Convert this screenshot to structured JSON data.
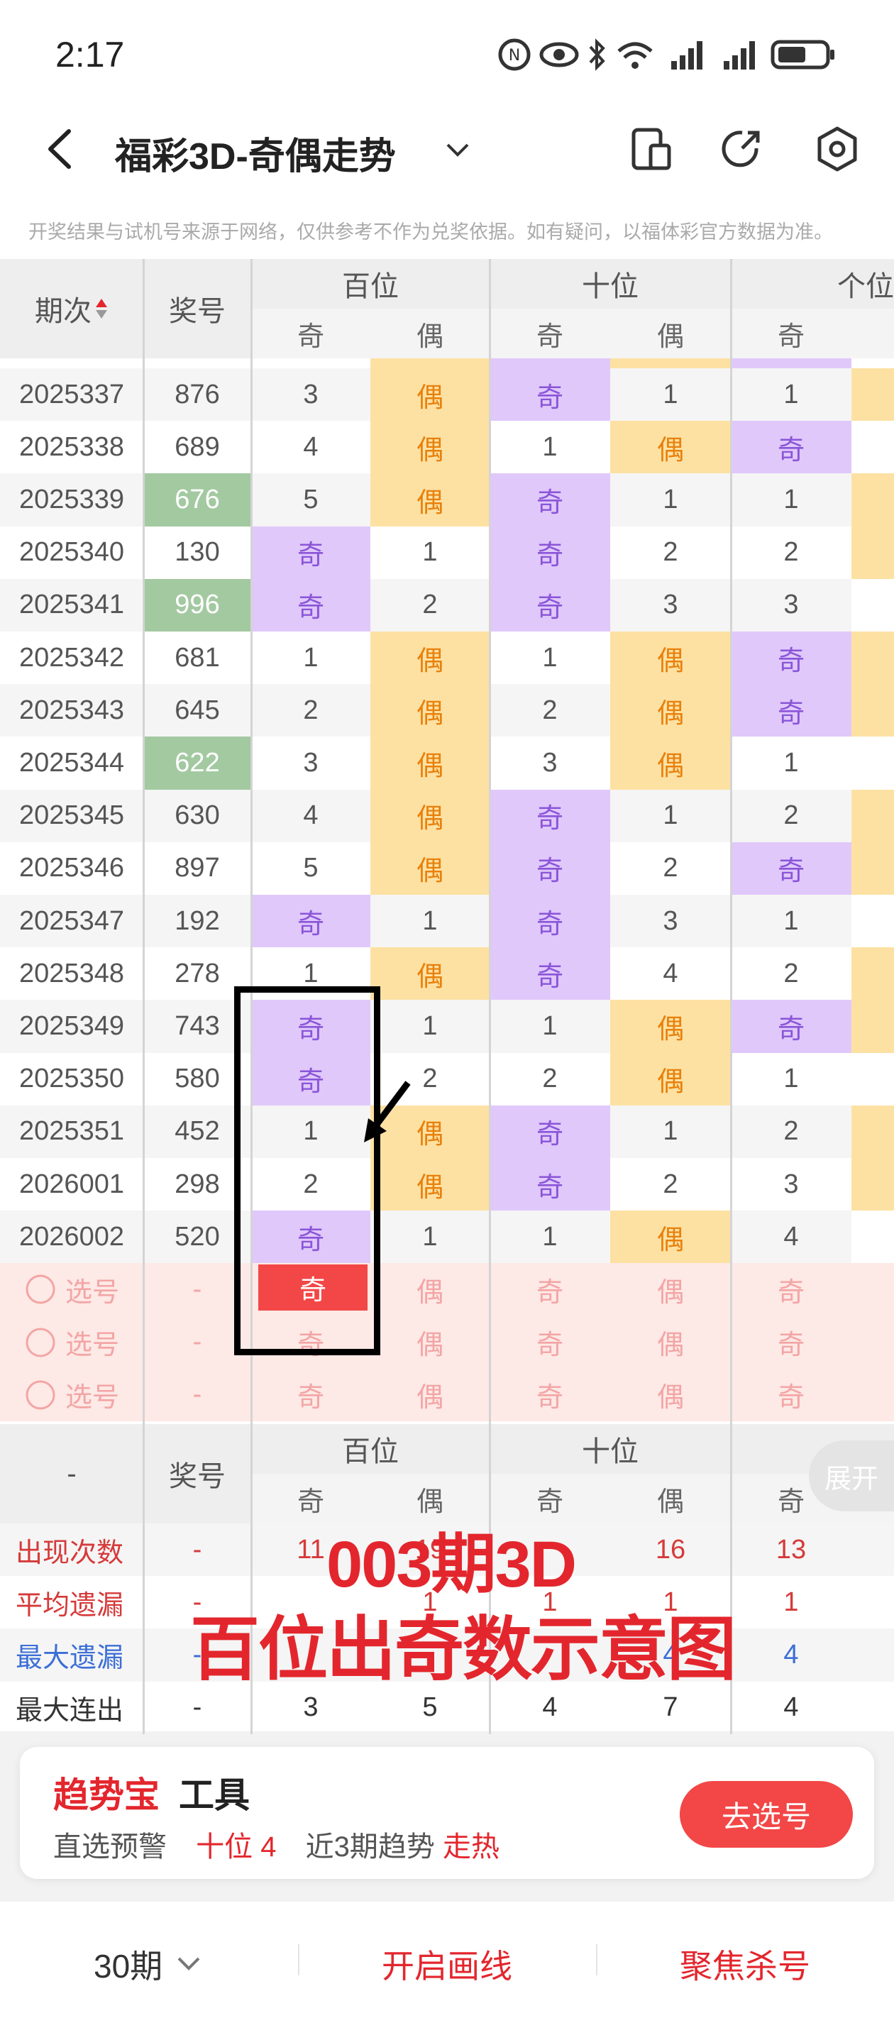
{
  "status": {
    "time": "2:17"
  },
  "header": {
    "title": "福彩3D-奇偶走势"
  },
  "disclaimer": "开奖结果与试机号来源于网络，仅供参考不作为兑奖依据。如有疑问，以福体彩官方数据为准。",
  "table": {
    "period_header": "期次",
    "number_header": "奖号",
    "groups": [
      "百位",
      "十位",
      "个位"
    ],
    "odd_label": "奇",
    "even_label": "偶",
    "rows": [
      {
        "period": "2025337",
        "num": "876",
        "hl": false,
        "c": [
          "3",
          "偶",
          "奇",
          "1",
          "1"
        ]
      },
      {
        "period": "2025338",
        "num": "689",
        "hl": false,
        "c": [
          "4",
          "偶",
          "1",
          "偶",
          "奇"
        ]
      },
      {
        "period": "2025339",
        "num": "676",
        "hl": true,
        "c": [
          "5",
          "偶",
          "奇",
          "1",
          "1"
        ]
      },
      {
        "period": "2025340",
        "num": "130",
        "hl": false,
        "c": [
          "奇",
          "1",
          "奇",
          "2",
          "2"
        ]
      },
      {
        "period": "2025341",
        "num": "996",
        "hl": true,
        "c": [
          "奇",
          "2",
          "奇",
          "3",
          "3"
        ]
      },
      {
        "period": "2025342",
        "num": "681",
        "hl": false,
        "c": [
          "1",
          "偶",
          "1",
          "偶",
          "奇"
        ]
      },
      {
        "period": "2025343",
        "num": "645",
        "hl": false,
        "c": [
          "2",
          "偶",
          "2",
          "偶",
          "奇"
        ]
      },
      {
        "period": "2025344",
        "num": "622",
        "hl": true,
        "c": [
          "3",
          "偶",
          "3",
          "偶",
          "1"
        ]
      },
      {
        "period": "2025345",
        "num": "630",
        "hl": false,
        "c": [
          "4",
          "偶",
          "奇",
          "1",
          "2"
        ]
      },
      {
        "period": "2025346",
        "num": "897",
        "hl": false,
        "c": [
          "5",
          "偶",
          "奇",
          "2",
          "奇"
        ]
      },
      {
        "period": "2025347",
        "num": "192",
        "hl": false,
        "c": [
          "奇",
          "1",
          "奇",
          "3",
          "1"
        ]
      },
      {
        "period": "2025348",
        "num": "278",
        "hl": false,
        "c": [
          "1",
          "偶",
          "奇",
          "4",
          "2"
        ]
      },
      {
        "period": "2025349",
        "num": "743",
        "hl": false,
        "c": [
          "奇",
          "1",
          "1",
          "偶",
          "奇"
        ]
      },
      {
        "period": "2025350",
        "num": "580",
        "hl": false,
        "c": [
          "奇",
          "2",
          "2",
          "偶",
          "1"
        ]
      },
      {
        "period": "2025351",
        "num": "452",
        "hl": false,
        "c": [
          "1",
          "偶",
          "奇",
          "1",
          "2"
        ]
      },
      {
        "period": "2026001",
        "num": "298",
        "hl": false,
        "c": [
          "2",
          "偶",
          "奇",
          "2",
          "3"
        ]
      },
      {
        "period": "2026002",
        "num": "520",
        "hl": false,
        "c": [
          "奇",
          "1",
          "1",
          "偶",
          "4"
        ]
      }
    ],
    "select_rows": [
      {
        "label": "选号",
        "num": "-",
        "c": [
          "奇",
          "偶",
          "奇",
          "偶",
          "奇"
        ],
        "selected": true
      },
      {
        "label": "选号",
        "num": "-",
        "c": [
          "奇",
          "偶",
          "奇",
          "偶",
          "奇"
        ],
        "selected": false
      },
      {
        "label": "选号",
        "num": "-",
        "c": [
          "奇",
          "偶",
          "奇",
          "偶",
          "奇"
        ],
        "selected": false
      }
    ],
    "stats_header": {
      "dash": "-",
      "number": "奖号"
    },
    "stats": [
      {
        "label": "出现次数",
        "color": "red",
        "num": "-",
        "c": [
          "11",
          "19",
          "",
          "16",
          "13"
        ]
      },
      {
        "label": "平均遗漏",
        "color": "red",
        "num": "-",
        "c": [
          "",
          "1",
          "1",
          "1",
          "1"
        ]
      },
      {
        "label": "最大遗漏",
        "color": "blue",
        "num": "-",
        "c": [
          "",
          "",
          "",
          "4",
          "4"
        ]
      },
      {
        "label": "最大连出",
        "color": "dark",
        "num": "-",
        "c": [
          "3",
          "5",
          "4",
          "7",
          "4"
        ]
      }
    ]
  },
  "expand_label": "展开",
  "annotation": {
    "title": "003期3D",
    "subtitle": "百位出奇数示意图"
  },
  "tool": {
    "brand": "趋势宝",
    "name": "工具",
    "line_prefix": "直选预警",
    "line_hl1": "十位 4",
    "line_mid": "近3期趋势",
    "line_hl2": "走热",
    "go_button": "去选号"
  },
  "bottom": {
    "periods": "30期",
    "draw_lines": "开启画线",
    "focus_kill": "聚焦杀号"
  }
}
